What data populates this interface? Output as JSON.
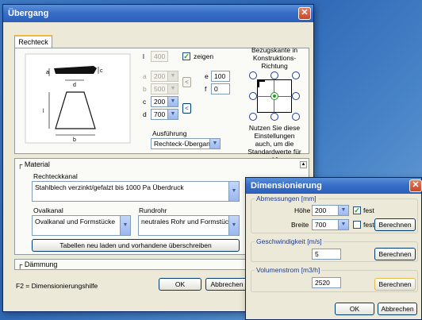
{
  "main": {
    "title": "Übergang",
    "tab_label": "Rechteck",
    "params": {
      "l": {
        "label": "l",
        "value": "400"
      },
      "zeigen": {
        "label": "zeigen",
        "checked": true
      },
      "a": {
        "label": "a",
        "value": "200"
      },
      "b": {
        "label": "b",
        "value": "500"
      },
      "c": {
        "label": "c",
        "value": "200"
      },
      "d": {
        "label": "d",
        "value": "700"
      },
      "e": {
        "label": "e",
        "value": "100"
      },
      "f": {
        "label": "f",
        "value": "0"
      },
      "lt": "<"
    },
    "ausfuehrung": {
      "label": "Ausführung",
      "value": "Rechteck-Übergang"
    },
    "bezugskante": {
      "title": "Bezugskante in Konstruktions-Richtung",
      "note": "Nutzen Sie diese Einstellungen auch, um die Standardwerte für e und f vom Programm ermitteln zu lassen"
    },
    "material": {
      "heading": "Material",
      "rechteckkanal_label": "Rechteckkanal",
      "rechteckkanal_value": "Stahlblech verzinkt/gefalzt bis 1000 Pa Überdruck",
      "ovalkanal_label": "Ovalkanal",
      "ovalkanal_value": "Ovalkanal und Formstücke",
      "rundrohr_label": "Rundrohr",
      "rundrohr_value": "neutrales Rohr und Formstücke",
      "reload_button": "Tabellen neu laden und vorhandene überschreiben"
    },
    "daemmung": {
      "heading": "Dämmung"
    },
    "footer_hint": "F2 = Dimensionierungshilfe",
    "ok": "OK",
    "cancel": "Abbrechen"
  },
  "dim": {
    "title": "Dimensionierung",
    "abmessungen": "Abmessungen [mm]",
    "hoehe": {
      "label": "Höhe",
      "value": "200",
      "fest_label": "fest",
      "fest": true
    },
    "breite": {
      "label": "Breite",
      "value": "700",
      "fest_label": "fest",
      "fest": false
    },
    "berechnen": "Berechnen",
    "geschwindigkeit": {
      "label": "Geschwindigkeit [m/s]",
      "value": "5"
    },
    "volumenstrom": {
      "label": "Volumenstrom [m3/h]",
      "value": "2520"
    },
    "ok": "OK",
    "cancel": "Abbrechen"
  },
  "colors": {
    "titlebar": "#2b5fbb",
    "accent": "#f1b73e",
    "close": "#c7472a"
  }
}
